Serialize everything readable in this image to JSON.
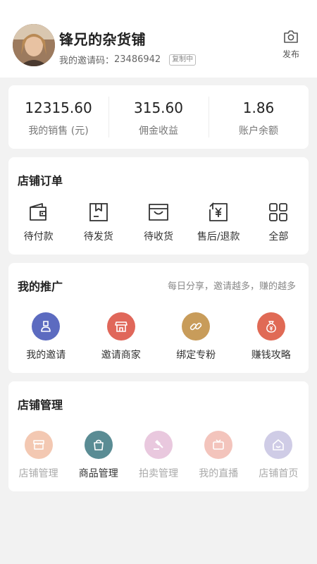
{
  "header": {
    "shop_name": "锋兄的杂货铺",
    "invite_label": "我的邀请码：",
    "invite_code": "23486942",
    "copy_badge": "复制中",
    "publish_label": "发布"
  },
  "stats": [
    {
      "value": "12315.60",
      "label": "我的销售 (元)"
    },
    {
      "value": "315.60",
      "label": "佣金收益"
    },
    {
      "value": "1.86",
      "label": "账户余额"
    }
  ],
  "orders": {
    "title": "店铺订单",
    "items": [
      {
        "label": "待付款",
        "icon": "wallet-icon"
      },
      {
        "label": "待发货",
        "icon": "box-icon"
      },
      {
        "label": "待收货",
        "icon": "cart-icon"
      },
      {
        "label": "售后/退款",
        "icon": "refund-icon"
      },
      {
        "label": "全部",
        "icon": "grid-icon"
      }
    ]
  },
  "promo": {
    "title": "我的推广",
    "subtitle": "每日分享，邀请越多，赚的越多",
    "items": [
      {
        "label": "我的邀请",
        "icon": "invite-icon",
        "color": "#5c6bc0"
      },
      {
        "label": "邀请商家",
        "icon": "store-icon",
        "color": "#e0675a"
      },
      {
        "label": "绑定专粉",
        "icon": "link-icon",
        "color": "#c89c5a"
      },
      {
        "label": "赚钱攻略",
        "icon": "money-bag-icon",
        "color": "#e06a55"
      }
    ]
  },
  "manage": {
    "title": "店铺管理",
    "items": [
      {
        "label": "店铺管理",
        "icon": "shop-icon",
        "color": "#f3c8b2",
        "active": false
      },
      {
        "label": "商品管理",
        "icon": "bag-icon",
        "color": "#5a8c94",
        "active": true
      },
      {
        "label": "拍卖管理",
        "icon": "gavel-icon",
        "color": "#e9c8de",
        "active": false
      },
      {
        "label": "我的直播",
        "icon": "tv-icon",
        "color": "#f3c4bc",
        "active": false
      },
      {
        "label": "店铺首页",
        "icon": "home-icon",
        "color": "#cfcce6",
        "active": false
      }
    ]
  }
}
